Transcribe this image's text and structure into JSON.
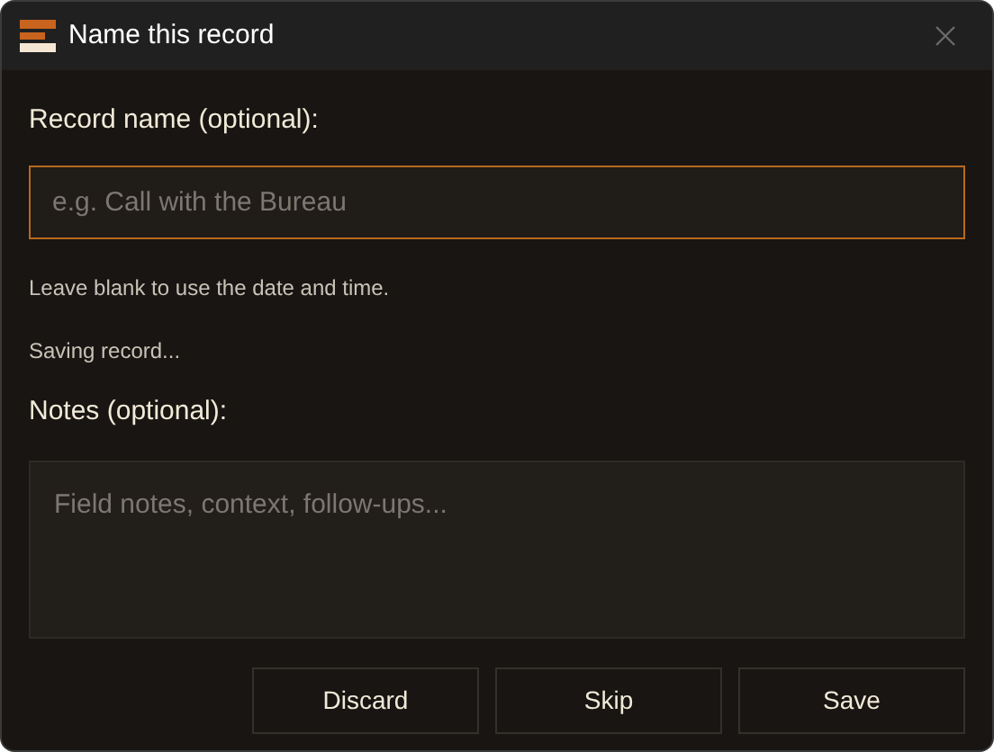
{
  "window": {
    "title": "Name this record"
  },
  "name_field": {
    "label": "Record name (optional):",
    "placeholder": "e.g. Call with the Bureau",
    "focused": true
  },
  "hint": "Leave blank to use the date and time.",
  "status": "Saving record...",
  "notes_field": {
    "label": "Notes (optional):",
    "placeholder": "Field notes, context, follow-ups..."
  },
  "buttons": [
    "Discard",
    "Skip",
    "Save"
  ]
}
